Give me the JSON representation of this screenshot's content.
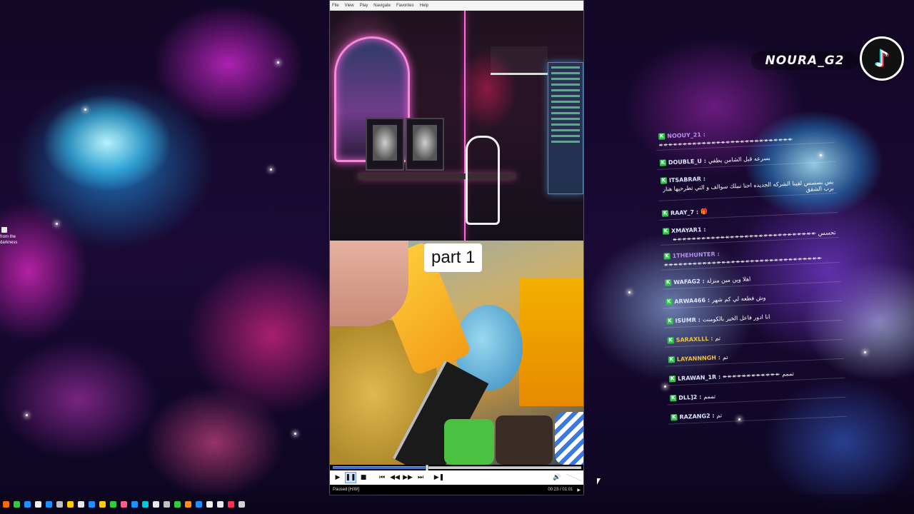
{
  "desktop": {
    "icon_caption": "from the darkness"
  },
  "player": {
    "menu": [
      "File",
      "View",
      "Play",
      "Navigate",
      "Favorites",
      "Help"
    ],
    "video": {
      "caption": "part 1"
    },
    "controls": {
      "play": "▶",
      "pause": "❚❚",
      "stop": "■",
      "prev": "⏮",
      "rewind": "◀◀",
      "forward": "▶▶",
      "next": "⏭",
      "frame_step": "▶❚",
      "volume": "🔊"
    },
    "seek_progress": 0.38,
    "status": {
      "state": "Paused [H/W]",
      "time": "00:23 / 01:01",
      "mode": "▶"
    }
  },
  "tiktok": {
    "username": "NOURA_G2",
    "logo": "♪"
  },
  "chat": {
    "badge": "K",
    "messages": [
      {
        "user": "NOOUY_21 :",
        "text": "↞↞↞↞↞↞↞↞↞↞↞↞↞↞↞↞↞↞↞↞↞↞↞↞↞↞↞↞",
        "style": "purple"
      },
      {
        "user": "DOUBLE_U :",
        "text": "بسرعه قبل الشامن يطفي",
        "style": ""
      },
      {
        "user": "ITSABRAR :",
        "text": "بس بسسس لقينا الشركه الجديده احنا نبيلك سوالف و التي تطرحيها هنار برب الشقق",
        "style": ""
      },
      {
        "user": "RAAY_7 :",
        "text": "🎁",
        "style": ""
      },
      {
        "user": "XMAYAR1 :",
        "text": "تحسس ↞↞↞↞↞↞↞↞↞↞↞↞↞↞↞↞↞↞↞↞↞↞↞↞↞↞↞↞↞↞",
        "style": ""
      },
      {
        "user": "1THEHUNTER :",
        "text": "↞↞↞↞↞↞↞↞↞↞↞↞↞↞↞↞↞↞↞↞↞↞↞↞↞↞↞↞↞↞↞↞↞",
        "style": "purple"
      },
      {
        "user": "WAFAG2 :",
        "text": "اهلا وين مين منزلة",
        "style": ""
      },
      {
        "user": "ARWA466 :",
        "text": "وش فطعه لي كم شهر",
        "style": ""
      },
      {
        "user": "ISUMR :",
        "text": "انا ادور فاعل الخير بالكومنت",
        "style": ""
      },
      {
        "user": "SARAXLLL :",
        "text": "تم",
        "style": "gold"
      },
      {
        "user": "LAYANNNGH :",
        "text": "تم",
        "style": "gold"
      },
      {
        "user": "LRAWAN_1R :",
        "text": "تممم ↞↞↞↞↞↞↞↞↞↞↞↞",
        "style": ""
      },
      {
        "user": "DLL]2 :",
        "text": "تممم",
        "style": ""
      },
      {
        "user": "RAZANG2 :",
        "text": "تم",
        "style": ""
      }
    ]
  },
  "taskbar": {
    "icons": [
      "#ff6a00",
      "#2ecc40",
      "#1e90ff",
      "#f0f0f0",
      "#1e90ff",
      "#c0c0c0",
      "#ffcc00",
      "#e8e8e8",
      "#1e90ff",
      "#ffd000",
      "#2ecc40",
      "#ff5a8a",
      "#1e90ff",
      "#00c8d8",
      "#e8e8e8",
      "#c0c0c0",
      "#2ecc40",
      "#ff8c1a",
      "#1e90ff",
      "#f0f0f0",
      "#e8e8e8",
      "#ff3050",
      "#d0d0d0"
    ]
  }
}
